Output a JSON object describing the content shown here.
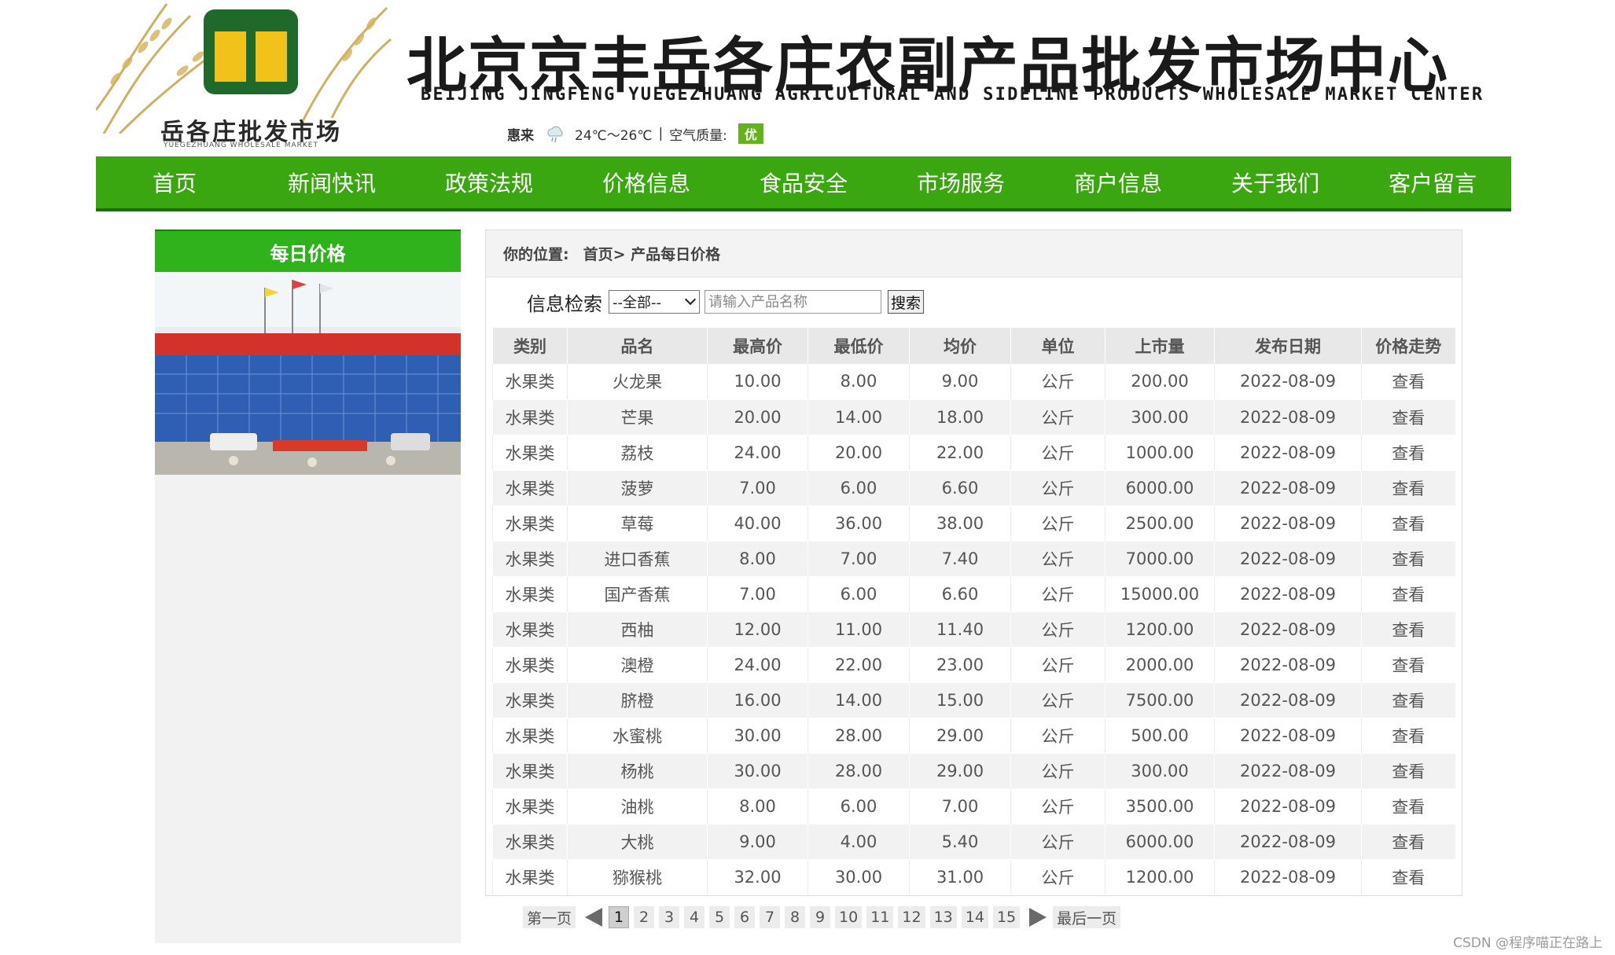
{
  "header": {
    "logo_text": "岳各庄批发市场",
    "logo_subtext": "YUEGEZHUANG WHOLESALE MARKET",
    "title": "北京京丰岳各庄农副产品批发市场中心",
    "title_en": "BEIJING JINGFENG YUEGEZHUANG AGRICULTURAL AND SIDELINE PRODUCTS WHOLESALE MARKET CENTER",
    "weather": {
      "city": "惠来",
      "icon": "weather-cloud-icon",
      "temperature": "24℃～26℃",
      "separator": "|",
      "air_quality_label": "空气质量:",
      "air_quality_value": "优",
      "air_quality_color": "#64b21c"
    }
  },
  "nav": {
    "items": [
      "首页",
      "新闻快讯",
      "政策法规",
      "价格信息",
      "食品安全",
      "市场服务",
      "商户信息",
      "关于我们",
      "客户留言"
    ],
    "color": "#3aa610"
  },
  "sidebar": {
    "title": "每日价格"
  },
  "main": {
    "breadcrumb": {
      "label": "你的位置:",
      "path": "首页> 产品每日价格"
    },
    "search": {
      "label": "信息检索",
      "category_selected": "--全部--",
      "placeholder": "请输入产品名称",
      "button_label": "搜索"
    },
    "table": {
      "columns": [
        "类别",
        "品名",
        "最高价",
        "最低价",
        "均价",
        "单位",
        "上市量",
        "发布日期",
        "价格走势"
      ],
      "rows": [
        [
          "水果类",
          "火龙果",
          "10.00",
          "8.00",
          "9.00",
          "公斤",
          "200.00",
          "2022-08-09",
          "查看"
        ],
        [
          "水果类",
          "芒果",
          "20.00",
          "14.00",
          "18.00",
          "公斤",
          "300.00",
          "2022-08-09",
          "查看"
        ],
        [
          "水果类",
          "荔枝",
          "24.00",
          "20.00",
          "22.00",
          "公斤",
          "1000.00",
          "2022-08-09",
          "查看"
        ],
        [
          "水果类",
          "菠萝",
          "7.00",
          "6.00",
          "6.60",
          "公斤",
          "6000.00",
          "2022-08-09",
          "查看"
        ],
        [
          "水果类",
          "草莓",
          "40.00",
          "36.00",
          "38.00",
          "公斤",
          "2500.00",
          "2022-08-09",
          "查看"
        ],
        [
          "水果类",
          "进口香蕉",
          "8.00",
          "7.00",
          "7.40",
          "公斤",
          "7000.00",
          "2022-08-09",
          "查看"
        ],
        [
          "水果类",
          "国产香蕉",
          "7.00",
          "6.00",
          "6.60",
          "公斤",
          "15000.00",
          "2022-08-09",
          "查看"
        ],
        [
          "水果类",
          "西柚",
          "12.00",
          "11.00",
          "11.40",
          "公斤",
          "1200.00",
          "2022-08-09",
          "查看"
        ],
        [
          "水果类",
          "澳橙",
          "24.00",
          "22.00",
          "23.00",
          "公斤",
          "2000.00",
          "2022-08-09",
          "查看"
        ],
        [
          "水果类",
          "脐橙",
          "16.00",
          "14.00",
          "15.00",
          "公斤",
          "7500.00",
          "2022-08-09",
          "查看"
        ],
        [
          "水果类",
          "水蜜桃",
          "30.00",
          "28.00",
          "29.00",
          "公斤",
          "500.00",
          "2022-08-09",
          "查看"
        ],
        [
          "水果类",
          "杨桃",
          "30.00",
          "28.00",
          "29.00",
          "公斤",
          "300.00",
          "2022-08-09",
          "查看"
        ],
        [
          "水果类",
          "油桃",
          "8.00",
          "6.00",
          "7.00",
          "公斤",
          "3500.00",
          "2022-08-09",
          "查看"
        ],
        [
          "水果类",
          "大桃",
          "9.00",
          "4.00",
          "5.40",
          "公斤",
          "6000.00",
          "2022-08-09",
          "查看"
        ],
        [
          "水果类",
          "猕猴桃",
          "32.00",
          "30.00",
          "31.00",
          "公斤",
          "1200.00",
          "2022-08-09",
          "查看"
        ]
      ]
    }
  },
  "pagination": {
    "first_label": "第一页",
    "last_label": "最后一页",
    "current_page": "1",
    "pages": [
      "1",
      "2",
      "3",
      "4",
      "5",
      "6",
      "7",
      "8",
      "9",
      "10",
      "11",
      "12",
      "13",
      "14",
      "15"
    ]
  },
  "watermark": "CSDN @程序喵正在路上"
}
